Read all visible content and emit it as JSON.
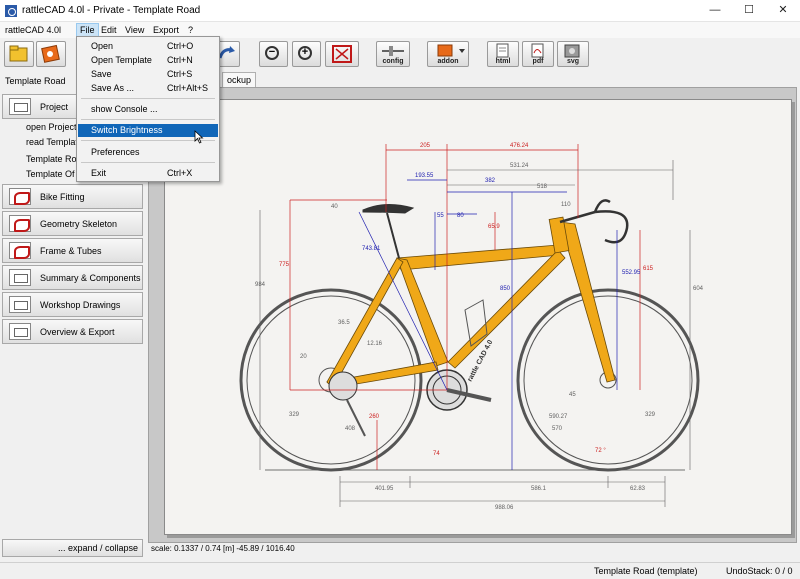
{
  "window": {
    "title": "rattleCAD 4.0l - Private - Template Road",
    "minimize": "—",
    "maximize": "☐",
    "close": "✕"
  },
  "menubar": {
    "items": [
      "rattleCAD 4.0l",
      "File",
      "Edit",
      "View",
      "Export",
      "?"
    ]
  },
  "file_menu": {
    "items": [
      {
        "label": "Open",
        "shortcut": "Ctrl+O"
      },
      {
        "label": "Open Template",
        "shortcut": "Ctrl+N"
      },
      {
        "label": "Save",
        "shortcut": "Ctrl+S"
      },
      {
        "label": "Save As ...",
        "shortcut": "Ctrl+Alt+S"
      },
      {
        "label": "show Console ...",
        "shortcut": ""
      },
      {
        "label": "Switch Brightness",
        "shortcut": ""
      },
      {
        "label": "Preferences",
        "shortcut": ""
      },
      {
        "label": "Exit",
        "shortcut": "Ctrl+X"
      }
    ],
    "highlighted": "Switch Brightness"
  },
  "toolbar": {
    "config_label": "config",
    "addon_label": "addon",
    "html_label": "html",
    "pdf_label": "pdf",
    "svg_label": "svg",
    "zoom_out": "−",
    "zoom_in": "+"
  },
  "sidebar": {
    "project_title": "Template Road",
    "project_button": "Project",
    "project_items": [
      "open Project",
      "read Template",
      "Template Ro",
      "Template Of"
    ],
    "buttons": [
      "Bike Fitting",
      "Geometry Skeleton",
      "Frame & Tubes",
      "Summary & Components",
      "Workshop Drawings",
      "Overview & Export"
    ],
    "expand_collapse": "... expand / collapse"
  },
  "tabs": [
    "ockup"
  ],
  "canvas": {
    "scale_text": "scale: 0.1337 / 0.74  [m]  -45.89 / 1016.40",
    "dimensions": {
      "d205": "205",
      "d476": "476.24",
      "d531": "531.24",
      "d193": "193.55",
      "d382": "382",
      "d518": "518",
      "d110": "110",
      "d40": "40",
      "d55": "55",
      "d80": "80",
      "d659": "65.9",
      "d775": "775",
      "d984": "984",
      "d74381": "743.81",
      "d850": "850",
      "d55295": "552.95",
      "d615": "615",
      "d604": "604",
      "d20": "20",
      "d1216": "12.16",
      "d365": "36.5",
      "d408": "408",
      "d260": "260",
      "d570": "570",
      "d74": "74",
      "d4195": "401.95",
      "d5861": "586.1",
      "d6283": "62.83",
      "d98806": "988.06",
      "d45": "45",
      "d59027": "590.27",
      "d329a": "329",
      "d329b": "329",
      "d72": "72 °",
      "decal": "rattle CAD 4.0"
    }
  },
  "status": {
    "template": "Template Road (template)",
    "undo": "UndoStack:  0 / 0"
  },
  "colors": {
    "frame": "#f0a818",
    "dim_red": "#cc2020",
    "dim_blue": "#2020b0",
    "dim_gray": "#606060",
    "highlight": "#1066b8"
  }
}
